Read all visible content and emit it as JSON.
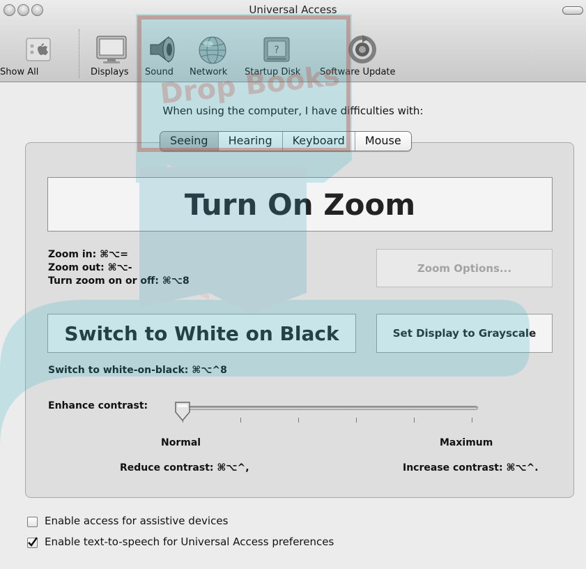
{
  "window": {
    "title": "Universal Access"
  },
  "toolbar": {
    "items": [
      {
        "label": "Show All",
        "icon": "apple-logo-icon"
      },
      {
        "label": "Displays",
        "icon": "display-icon"
      },
      {
        "label": "Sound",
        "icon": "speaker-icon"
      },
      {
        "label": "Network",
        "icon": "globe-icon"
      },
      {
        "label": "Startup Disk",
        "icon": "hard-disk-icon"
      },
      {
        "label": "Software Update",
        "icon": "software-update-icon"
      }
    ]
  },
  "main": {
    "prompt": "When using the computer, I have difficulties with:",
    "tabs": [
      {
        "label": "Seeing",
        "selected": true
      },
      {
        "label": "Hearing",
        "selected": false
      },
      {
        "label": "Keyboard",
        "selected": false
      },
      {
        "label": "Mouse",
        "selected": false
      }
    ],
    "zoom": {
      "button_label": "Turn On Zoom",
      "options_label": "Zoom Options...",
      "shortcuts": [
        "Zoom in: ⌘⌥=",
        "Zoom out: ⌘⌥-",
        "Turn zoom on or off: ⌘⌥8"
      ]
    },
    "display": {
      "white_on_black_label": "Switch to White on Black",
      "grayscale_label": "Set Display to Grayscale",
      "white_on_black_shortcut": "Switch to white-on-black: ⌘⌥^8"
    },
    "contrast": {
      "label": "Enhance contrast:",
      "value": 0,
      "tick_count": 6,
      "min_label": "Normal",
      "max_label": "Maximum",
      "reduce_shortcut": "Reduce contrast: ⌘⌥^,",
      "increase_shortcut": "Increase contrast: ⌘⌥^."
    }
  },
  "footer": {
    "assistive": {
      "label": "Enable access for assistive devices",
      "checked": false
    },
    "tts": {
      "label": "Enable text-to-speech for Universal Access preferences",
      "checked": true
    }
  },
  "watermark": {
    "text": "Drop Books"
  },
  "colors": {
    "watermark": "#2fb4c4",
    "watermark_red": "#c0392b"
  }
}
